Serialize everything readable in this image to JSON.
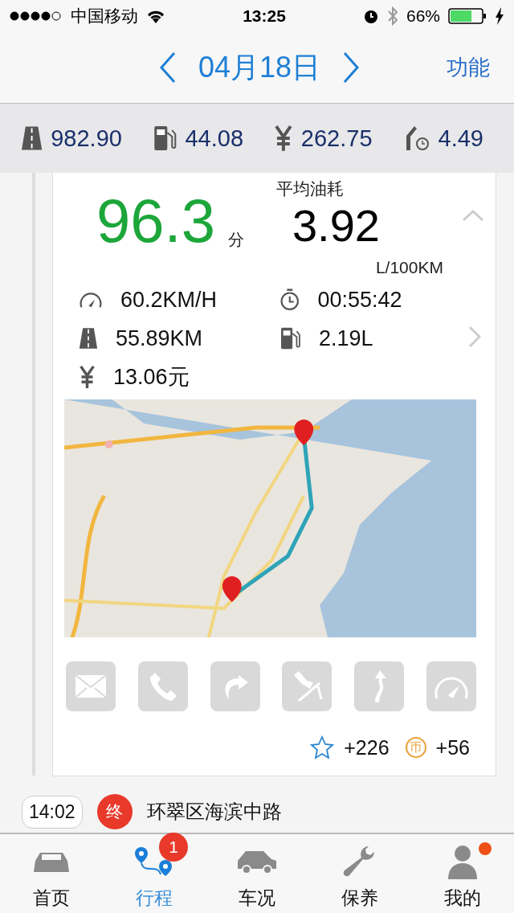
{
  "status_bar": {
    "carrier": "中国移动",
    "time": "13:25",
    "battery": "66%"
  },
  "nav": {
    "date": "04月18日",
    "action": "功能"
  },
  "summary": [
    {
      "kind": "road",
      "value": "982.90"
    },
    {
      "kind": "fuel",
      "value": "44.08"
    },
    {
      "kind": "cost",
      "value": "262.75"
    },
    {
      "kind": "consumption",
      "value": "4.49"
    }
  ],
  "trip": {
    "score": "96.3",
    "score_unit": "分",
    "avg_label": "平均油耗",
    "avg": "3.92",
    "avg_unit": "L/100KM",
    "expanded": true,
    "details": [
      {
        "kind": "speed",
        "value": "60.2KM/H"
      },
      {
        "kind": "time",
        "value": "00:55:42"
      },
      {
        "kind": "road",
        "value": "55.89KM"
      },
      {
        "kind": "fuel",
        "value": "2.19L"
      },
      {
        "kind": "cost",
        "value": "13.06元"
      }
    ],
    "actions": [
      {
        "kind": "mail"
      },
      {
        "kind": "phone"
      },
      {
        "kind": "share"
      },
      {
        "kind": "brake"
      },
      {
        "kind": "curve"
      },
      {
        "kind": "gauge"
      }
    ],
    "points": {
      "stars": "+226",
      "coin_symbol": "币",
      "coins": "+56"
    }
  },
  "end": {
    "time": "14:02",
    "badge": "终",
    "address": "环翠区海滨中路"
  },
  "tabs": [
    {
      "kind": "home",
      "label": "首页",
      "selected": false,
      "dot": false
    },
    {
      "kind": "trip",
      "label": "行程",
      "selected": true,
      "badge": "1",
      "dot": false
    },
    {
      "kind": "car",
      "label": "车况",
      "selected": false,
      "dot": false
    },
    {
      "kind": "service",
      "label": "保养",
      "selected": false,
      "dot": false
    },
    {
      "kind": "me",
      "label": "我的",
      "selected": false,
      "dot": true
    }
  ]
}
